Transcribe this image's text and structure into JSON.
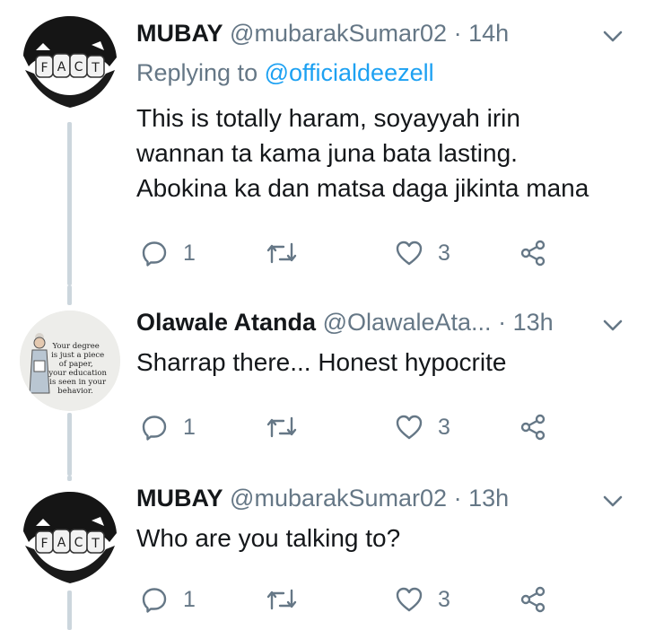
{
  "tweets": [
    {
      "avatar": {
        "kind": "fact",
        "letters": [
          "F",
          "A",
          "C",
          "T"
        ]
      },
      "name": "MUBAY",
      "handle": "@mubarakSumar02",
      "dot": "·",
      "time": "14h",
      "replying_prefix": "Replying to ",
      "replying_to": "@officialdeezell",
      "text_lines": [
        "This is totally haram, soyayyah irin",
        "wannan ta kama juna bata lasting.",
        "Abokina ka dan matsa daga jikinta mana"
      ],
      "reply_count": "1",
      "like_count": "3"
    },
    {
      "avatar": {
        "kind": "quote",
        "quote_lines": [
          "Your degree",
          "is just a piece",
          "of paper,",
          "your education",
          "is seen in your",
          "behavior."
        ]
      },
      "name": "Olawale Atanda",
      "handle": "@OlawaleAta...",
      "dot": "·",
      "time": "13h",
      "text_lines": [
        "Sharrap there... Honest hypocrite"
      ],
      "reply_count": "1",
      "like_count": "3"
    },
    {
      "avatar": {
        "kind": "fact",
        "letters": [
          "F",
          "A",
          "C",
          "T"
        ]
      },
      "name": "MUBAY",
      "handle": "@mubarakSumar02",
      "dot": "·",
      "time": "13h",
      "text_lines": [
        "Who are you talking to?"
      ],
      "reply_count": "1",
      "like_count": "3"
    }
  ],
  "colors": {
    "text": "#14171a",
    "secondary": "#657786",
    "link": "#1da1f2",
    "thread_line": "#ccd6dd"
  },
  "icons": [
    "reply-icon",
    "retweet-icon",
    "like-icon",
    "share-icon",
    "chevron-down-icon"
  ]
}
